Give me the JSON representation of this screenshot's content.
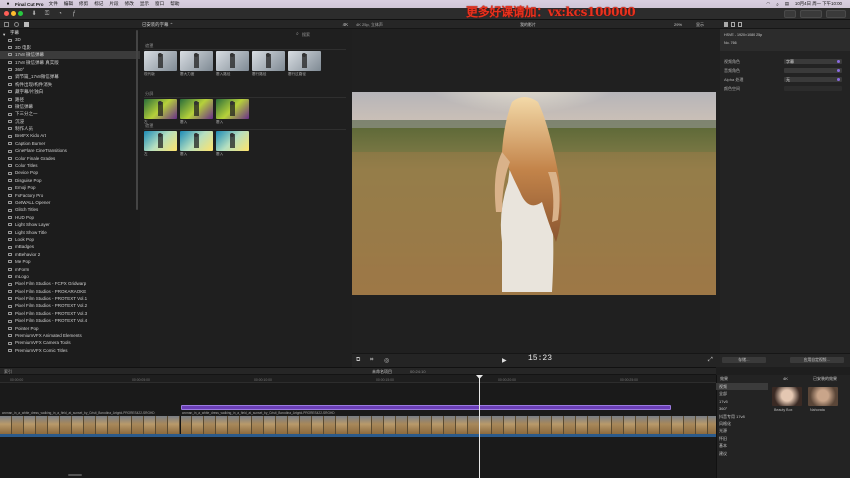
{
  "menubar": {
    "app_name": "Final Cut Pro",
    "menus": [
      "文件",
      "编辑",
      "修剪",
      "标记",
      "片段",
      "修改",
      "显示",
      "窗口",
      "帮助"
    ],
    "clock": "10月4日 周一 下午10:00"
  },
  "watermark": "更多好课请加：vx:kcs100000",
  "browser": {
    "header": "已安装的字幕 ⌃",
    "resolution": "4K",
    "search_placeholder": "搜索",
    "sections": [
      {
        "label": "遮罩",
        "items": [
          "现代版",
          "履大力度",
          "履入路径",
          "履行路径",
          "履行过路径"
        ]
      },
      {
        "label": "分屏",
        "items": [
          "左",
          "履入",
          "履入"
        ]
      },
      {
        "label": "遮罩",
        "items": [
          "左",
          "履入",
          "履入"
        ]
      }
    ]
  },
  "library": {
    "items": [
      "字幕",
      "3D",
      "3D 电影",
      "17v8 微信弹幕",
      "17v8 微信弹幕 真实版",
      "360°",
      "调节篇_17v8微信弹幕",
      "构件出现/构件消失",
      "藏字幕/片独白",
      "路径",
      "微信弹幕",
      "下三分之一",
      "沉浸",
      "制作人员",
      "BretFX Kido Art",
      "Caption Burner",
      "CineFlare CineTransitions",
      "Color Finale Grades",
      "Color Titles",
      "Device Pop",
      "Disguise Pop",
      "Emoji Pop",
      "FxFactory Pro",
      "GetWALL Opener",
      "Glitch Titles",
      "HUD Pop",
      "Light Show Layer",
      "Light Show Title",
      "Look Pop",
      "mBadges",
      "mBehavior 2",
      "Me Pop",
      "mForm",
      "mLogo",
      "Pixel Film Studios - FCPX Gridwarp",
      "Pixel Film Studios - PROKARAOKE",
      "Pixel Film Studios - PROTEXT Vol.1",
      "Pixel Film Studios - PROTEXT Vol.2",
      "Pixel Film Studios - PROTEXT Vol.3",
      "Pixel Film Studios - PROTEXT Vol.4",
      "Pointer Pop",
      "PremiumVFX Animated Elements",
      "PremiumVFX Camera Tools",
      "PremiumVFX Comic Titles"
    ],
    "selected_index": 3
  },
  "viewer": {
    "zoom_label": "4K 25p, 立体声",
    "center_label": "我的影片",
    "zoom_percent": "29%",
    "display_label": "显示",
    "timecode": "15:23"
  },
  "inspector": {
    "name_line": "HSVE - 1920×1080 25p",
    "number_line": "No. 766",
    "rows": [
      {
        "label": "视频角色",
        "value": "字幕"
      },
      {
        "label": "音频角色",
        "value": ""
      },
      {
        "label": "Alpha 处理",
        "value": "无"
      },
      {
        "label": "颜色空间",
        "value": ""
      }
    ],
    "save_button": "存储…",
    "apply_button": "应用自定视频…"
  },
  "timeline": {
    "header_center": "未命名项目",
    "duration": "00:24:10",
    "ticks": [
      "00:00:00",
      "00:00:05:00",
      "00:00:10:00",
      "00:00:15:00",
      "00:00:20:00",
      "00:00:25:00"
    ],
    "clip_label": "woman_in_a_white_dress_walking_in_a_field_at_sunset_by_Cristi_Borodina_Artgrid-PRORES422-SRGHD",
    "playhead_fraction": 0.669
  },
  "effects": {
    "header": "效果",
    "right_header": "已安装的效果",
    "resolution": "4K",
    "items": [
      "视频",
      "全部",
      "17v5",
      "360°",
      "抖音专用 17v8",
      "风格化",
      "光源",
      "怀旧",
      "基本",
      "建议"
    ],
    "selected_index": 0,
    "thumbs": [
      "Beauty Box",
      "Nahorata"
    ]
  }
}
